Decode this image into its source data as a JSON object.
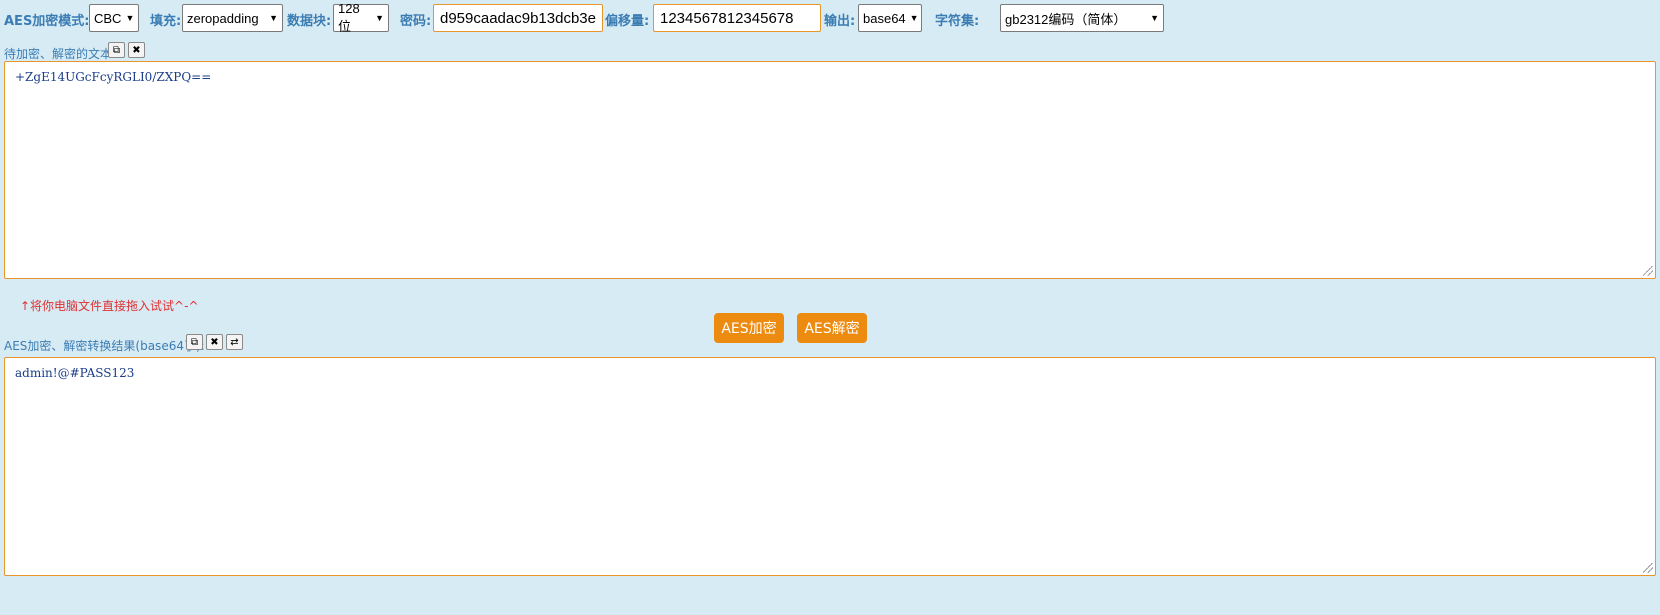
{
  "toolbar": {
    "mode_label": "AES加密模式:",
    "mode_value": "CBC",
    "padding_label": "填充:",
    "padding_value": "zeropadding",
    "block_label": "数据块:",
    "block_value": "128位",
    "key_label": "密码:",
    "key_value": "d959caadac9b13dcb3e",
    "iv_label": "偏移量:",
    "iv_value": "1234567812345678",
    "output_label": "输出:",
    "output_value": "base64",
    "charset_label": "字符集:",
    "charset_value": "gb2312编码（简体）"
  },
  "input_section": {
    "label": "待加密、解密的文本:",
    "copy_icon": "copy-icon",
    "clear_icon": "close-icon",
    "text": "+ZgE14UGcFcyRGLI0/ZXPQ=="
  },
  "hint": "↑将你电脑文件直接拖入试试^-^",
  "actions": {
    "encrypt_label": "AES加密",
    "decrypt_label": "AES解密",
    "accent_color": "#ed8a10"
  },
  "output_section": {
    "label": "AES加密、解密转换结果(base64了):",
    "copy_icon": "copy-icon",
    "clear_icon": "close-icon",
    "swap_icon": "swap-icon",
    "text": "admin!@#PASS123"
  }
}
